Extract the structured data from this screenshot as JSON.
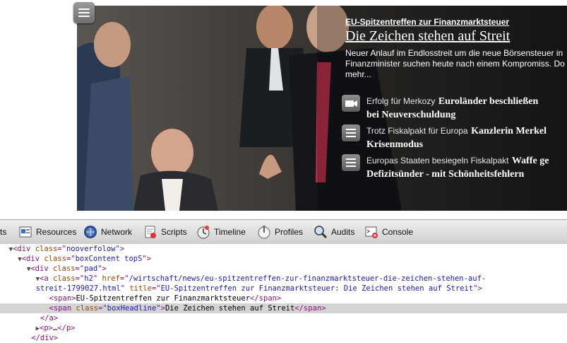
{
  "article": {
    "kicker": "EU-Spitzentreffen zur Finanzmarktsteuer",
    "headline": "Die Zeichen stehen auf Streit",
    "lead": "Neuer Anlauf im Endlosstreit um die neue Börsensteuer in Finanzminister suchen heute nach einem Kompromiss. Do mehr..."
  },
  "related": [
    {
      "kicker": "Erfolg für Merkozy",
      "headline_1": "Euroländer beschließen",
      "headline_2": "bei Neuverschuldung",
      "icon": "video-icon"
    },
    {
      "kicker": "Trotz Fiskalpakt für Europa",
      "headline_1": "Kanzlerin Merkel",
      "headline_2": "Krisenmodus",
      "icon": "article-icon"
    },
    {
      "kicker": "Europas Staaten besiegeln Fiskalpakt",
      "headline_1": "Waffe ge",
      "headline_2": "Defizitsünder - mit Schönheitsfehlern",
      "icon": "article-icon"
    }
  ],
  "toolbar": {
    "elements_fragment": "ts",
    "resources": "Resources",
    "network": "Network",
    "scripts": "Scripts",
    "timeline": "Timeline",
    "profiles": "Profiles",
    "audits": "Audits",
    "console": "Console"
  },
  "dom": {
    "l1": {
      "t1": "<div ",
      "a1": "class",
      "t2": "=\"",
      "v1": "nooverfolow",
      "t3": "\">"
    },
    "l2": {
      "t1": "<div ",
      "a1": "class",
      "t2": "=\"",
      "v1": "boxContent topS",
      "t3": "\">"
    },
    "l3": {
      "t1": "<div ",
      "a1": "class",
      "t2": "=\"",
      "v1": "pad",
      "t3": "\">"
    },
    "l4": {
      "t1": "<a ",
      "a1": "class",
      "t2": "=\"",
      "v1": "h2",
      "t3": "\" ",
      "a2": "href",
      "t4": "=\"",
      "v2": "/wirtschaft/news/eu-spitzentreffen-zur-finanzmarktsteuer-die-zeichen-stehen-auf-"
    },
    "l5": {
      "v1": "streit-1799027.html",
      "t1": "\" ",
      "a1": "title",
      "t2": "=\"",
      "v2": "EU-Spitzentreffen zur Finanzmarktsteuer: Die Zeichen stehen auf Streit",
      "t3": "\">"
    },
    "l6": {
      "t1": "<span>",
      "x1": "EU-Spitzentreffen zur Finanzmarktsteuer",
      "t2": "</span>"
    },
    "l7": {
      "t1": "<span ",
      "a1": "class",
      "t2": "=\"",
      "v1": "boxHeadline",
      "t3": "\">",
      "x1": "Die Zeichen stehen auf Streit",
      "t4": "</span>"
    },
    "l8": {
      "t1": "</a>"
    },
    "l9": {
      "t1": "<p>",
      "x1": "…",
      "t2": "</p>"
    },
    "l10": {
      "t1": "</div>"
    }
  },
  "colors": {
    "tag": "#881280",
    "attr_name": "#994500",
    "attr_value": "#1a1aa6",
    "selected_row": "#d4d4d4"
  }
}
